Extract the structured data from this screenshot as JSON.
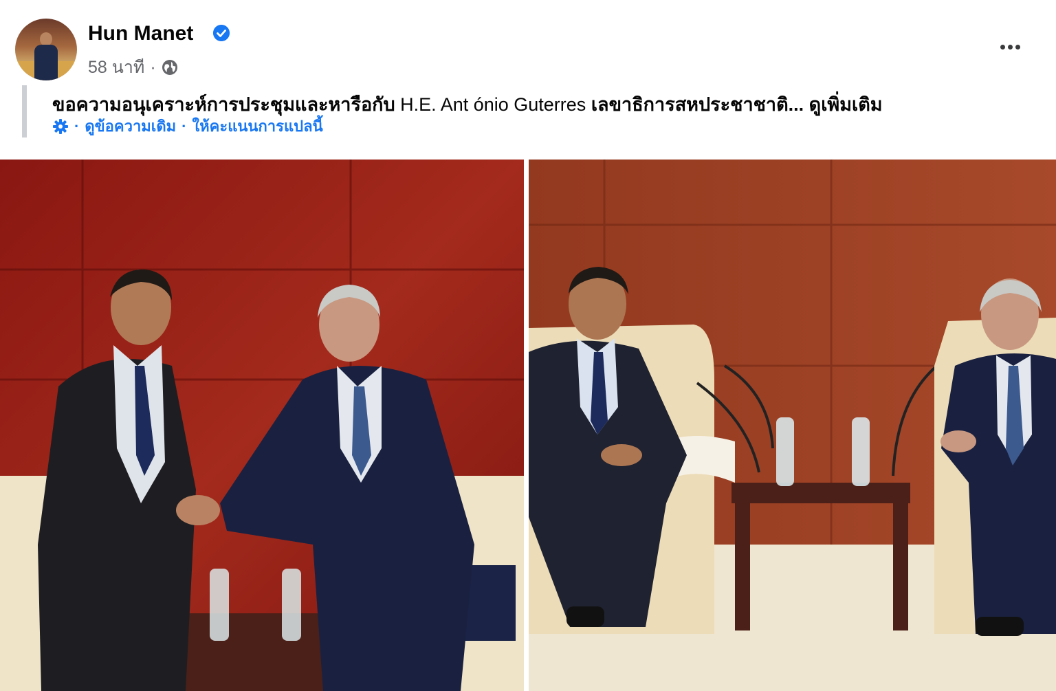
{
  "post": {
    "author": "Hun Manet",
    "verified": true,
    "time": "58 นาที",
    "separator": "·",
    "privacy_icon": "globe-icon",
    "text_prefix": "ขอความอนุเคราะห์การประชุมและหารือกับ",
    "text_name": " H.E. Ant ónio Guterres ",
    "text_suffix": "เลขาธิการสหประชาชาติ...",
    "see_more": "ดูเพิ่มเติม",
    "translation": {
      "see_original": "ดูข้อความเดิม",
      "rate": "ให้คะแนนการแปลนี้",
      "separator": "·"
    }
  },
  "colors": {
    "link": "#1877f2",
    "meta": "#65676b",
    "wall_left": "#8e1a16",
    "wall_right": "#9b3a24"
  }
}
